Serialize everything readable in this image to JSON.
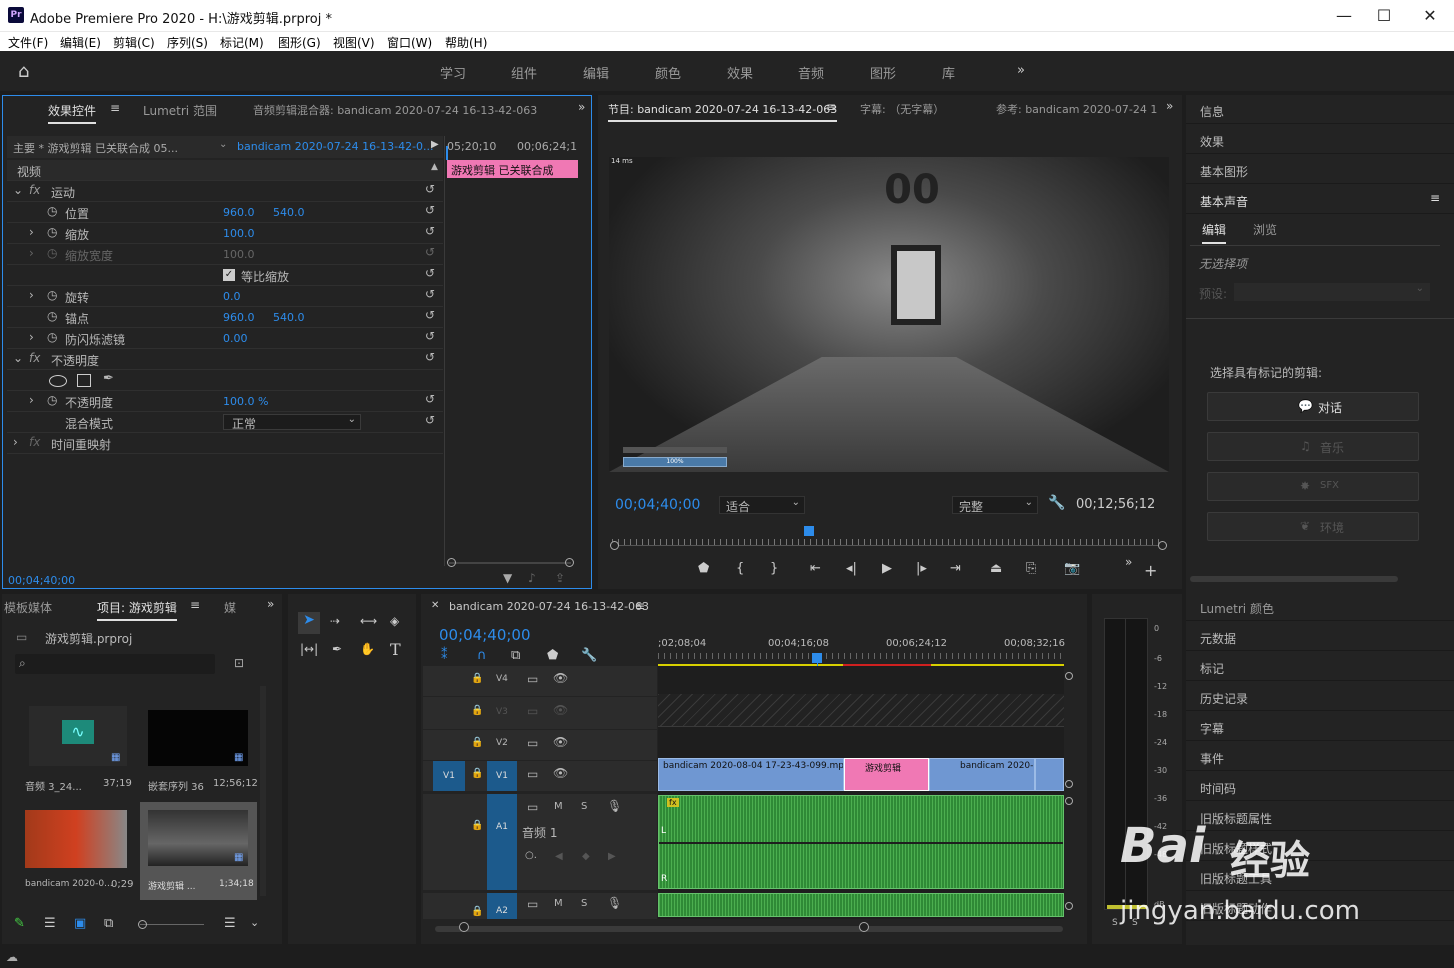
{
  "window": {
    "title": "Adobe Premiere Pro 2020 - H:\\游戏剪辑.prproj *",
    "logo": "Pr"
  },
  "menu": [
    "文件(F)",
    "编辑(E)",
    "剪辑(C)",
    "序列(S)",
    "标记(M)",
    "图形(G)",
    "视图(V)",
    "窗口(W)",
    "帮助(H)"
  ],
  "workspaces": [
    "学习",
    "组件",
    "编辑",
    "颜色",
    "效果",
    "音频",
    "图形",
    "库"
  ],
  "effects": {
    "tabs": [
      "效果控件",
      "Lumetri 范围",
      "音频剪辑混合器: bandicam 2020-07-24 16-13-42-063"
    ],
    "master": "主要 * 游戏剪辑 已关联合成 05...",
    "clip": "bandicam 2020-07-24 16-13-42-0...",
    "tc1": "05;20;10",
    "tc2": "00;06;24;1",
    "clip_label": "游戏剪辑 已关联合成",
    "section_video": "视频",
    "motion": "运动",
    "position": "位置",
    "pos_x": "960.0",
    "pos_y": "540.0",
    "scale": "缩放",
    "scale_v": "100.0",
    "scale_w": "缩放宽度",
    "scale_w_v": "100.0",
    "uniform": "等比缩放",
    "rotation": "旋转",
    "rotation_v": "0.0",
    "anchor": "锚点",
    "anchor_x": "960.0",
    "anchor_y": "540.0",
    "flicker": "防闪烁滤镜",
    "flicker_v": "0.00",
    "opacity": "不透明度",
    "opacity_p": "不透明度",
    "opacity_v": "100.0 %",
    "blend": "混合模式",
    "blend_v": "正常",
    "timeremap": "时间重映射",
    "timecode": "00;04;40;00"
  },
  "program": {
    "tabs": [
      "节目: bandicam 2020-07-24 16-13-42-063",
      "字幕: （无字幕）",
      "参考: bandicam 2020-07-24 1"
    ],
    "timecode": "00;04;40;00",
    "fit": "适合",
    "quality": "完整",
    "duration": "00;12;56;12",
    "hud_ms": "14 ms",
    "hud_pct": "100%"
  },
  "right": {
    "items_top": [
      "信息",
      "效果",
      "基本图形"
    ],
    "essential": "基本声音",
    "tab_edit": "编辑",
    "tab_browse": "浏览",
    "no_selection": "无选择项",
    "preset": "预设:",
    "select_label": "选择具有标记的剪辑:",
    "buttons": [
      "对话",
      "音乐",
      "SFX",
      "环境"
    ],
    "items_bottom": [
      "Lumetri 颜色",
      "元数据",
      "标记",
      "历史记录",
      "字幕",
      "事件",
      "时间码",
      "旧版标题属性",
      "旧版标题样式",
      "旧版标题工具",
      "旧版标题动作"
    ]
  },
  "project": {
    "tabs": [
      "模板媒体",
      "项目: 游戏剪辑",
      "媒"
    ],
    "file": "游戏剪辑.prproj",
    "items": [
      {
        "name": "音频 3_24...",
        "dur": "37;19"
      },
      {
        "name": "嵌套序列 36",
        "dur": "12;56;12"
      },
      {
        "name": "bandicam 2020-0...",
        "dur": "0;29"
      },
      {
        "name": "游戏剪辑 ...",
        "dur": "1;34;18"
      }
    ]
  },
  "timeline": {
    "tab": "bandicam 2020-07-24 16-13-42-063",
    "timecode": "00;04;40;00",
    "ruler": [
      ";02;08;04",
      "00;04;16;08",
      "00;06;24;12",
      "00;08;32;16"
    ],
    "tracks": [
      "V4",
      "V3",
      "V2",
      "V1",
      "A1",
      "A2"
    ],
    "src": "V1",
    "audio_name": "音频 1",
    "clips": [
      "bandicam 2020-08-04 17-23-43-099.mp4",
      "游戏剪辑",
      "bandicam 2020-0"
    ],
    "mute": "M",
    "solo": "S"
  },
  "meter": {
    "ticks": [
      "0",
      "-6",
      "-12",
      "-18",
      "-24",
      "-30",
      "-36",
      "-42",
      "-48",
      "dB"
    ],
    "s": "S"
  },
  "watermark": {
    "brand": "Bai",
    "brand2": "经验",
    "url": "jingyan.baidu.com"
  }
}
